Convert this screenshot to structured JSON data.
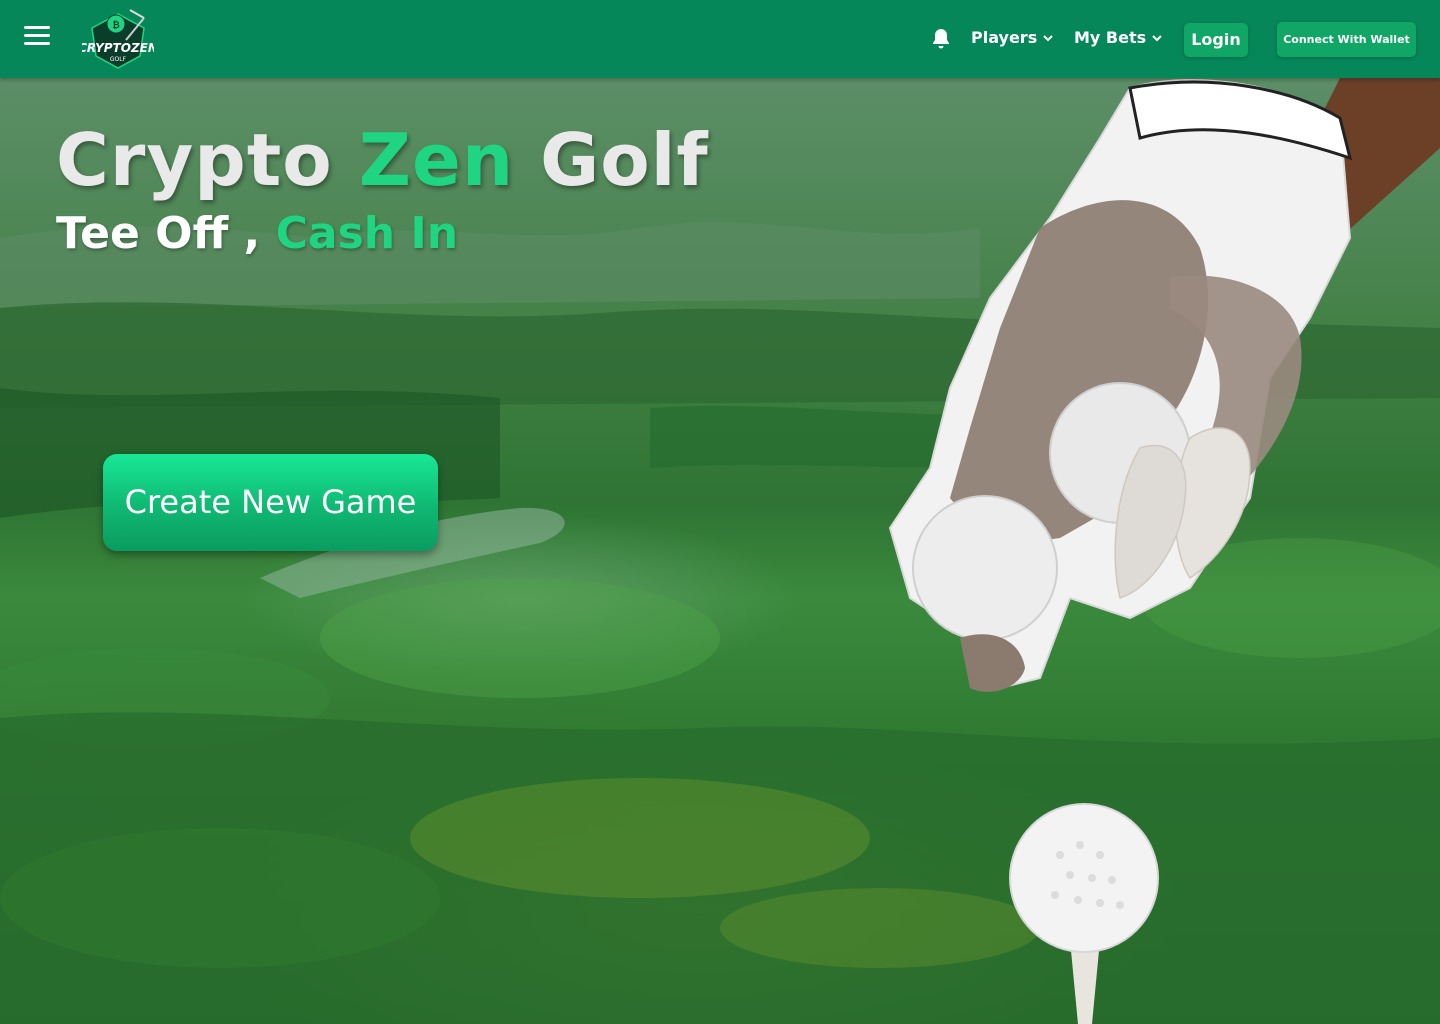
{
  "header": {
    "menu_icon": "hamburger-menu-icon",
    "logo_text": "CRYPTOZEN",
    "logo_subtext": "GOLF",
    "notification_icon": "bell-icon",
    "nav": [
      {
        "label": "Players",
        "icon": "chevron-down-icon"
      },
      {
        "label": "My Bets",
        "icon": "chevron-down-icon"
      }
    ],
    "login_label": "Login",
    "wallet_label": "Connect With Wallet"
  },
  "hero": {
    "title_part1": "Crypto",
    "title_part2": "Zen",
    "title_part3": "Golf",
    "subtitle_part1": "Tee Off ,",
    "subtitle_part2": "Cash In",
    "cta_label": "Create New Game"
  },
  "colors": {
    "header_bg": "#05875a",
    "button_bg": "#10a766",
    "accent": "#1fd582",
    "title_text": "#e9e9e9"
  }
}
